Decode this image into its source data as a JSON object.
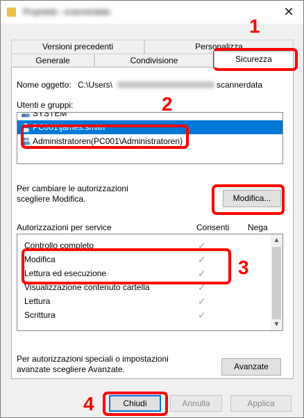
{
  "window": {
    "title": "Proprietà - scannerdata",
    "close_glyph": "✕"
  },
  "tabs": {
    "row_back": [
      {
        "label": "Versioni precedenti"
      },
      {
        "label": "Personalizza"
      }
    ],
    "row_front": [
      {
        "label": "Generale"
      },
      {
        "label": "Condivisione"
      },
      {
        "label": "Sicurezza",
        "active": true
      }
    ]
  },
  "security": {
    "object_name_label": "Nome oggetto:",
    "object_name_prefix": "C:\\Users\\",
    "object_name_suffix": "scannerdata",
    "groups_label": "Utenti e gruppi:",
    "users": [
      {
        "label": "SYSTEM",
        "icon": "group-icon"
      },
      {
        "label": "PC001\\james.smith",
        "icon": "user-icon",
        "selected": true
      },
      {
        "label": "Administratoren(PC001\\Administratoren)",
        "icon": "group-icon"
      }
    ],
    "change_text_line1": "Per cambiare le autorizzazioni",
    "change_text_line2": "scegliere Modifica.",
    "edit_button": "Modifica...",
    "perms_label": "Autorizzazioni per service",
    "allow_header": "Consenti",
    "deny_header": "Nega",
    "permissions": [
      {
        "name": "Controllo completo",
        "allow": true
      },
      {
        "name": "Modifica",
        "allow": true
      },
      {
        "name": "Lettura ed esecuzione",
        "allow": true
      },
      {
        "name": "Visualizzazione contenuto cartella",
        "allow": true
      },
      {
        "name": "Lettura",
        "allow": true
      },
      {
        "name": "Scrittura",
        "allow": true
      }
    ],
    "check_glyph": "✓",
    "advanced_text_line1": "Per autorizzazioni speciali o impostazioni",
    "advanced_text_line2": "avanzate scegliere Avanzate.",
    "advanced_button": "Avanzate"
  },
  "footer": {
    "close_button": "Chiudi",
    "cancel_button": "Annulla",
    "apply_button": "Applica"
  },
  "annotations": [
    {
      "number": "1"
    },
    {
      "number": "2"
    },
    {
      "number": "3"
    },
    {
      "number": "4"
    }
  ],
  "colors": {
    "annotation": "#ff0000",
    "selection": "#0078d7"
  }
}
